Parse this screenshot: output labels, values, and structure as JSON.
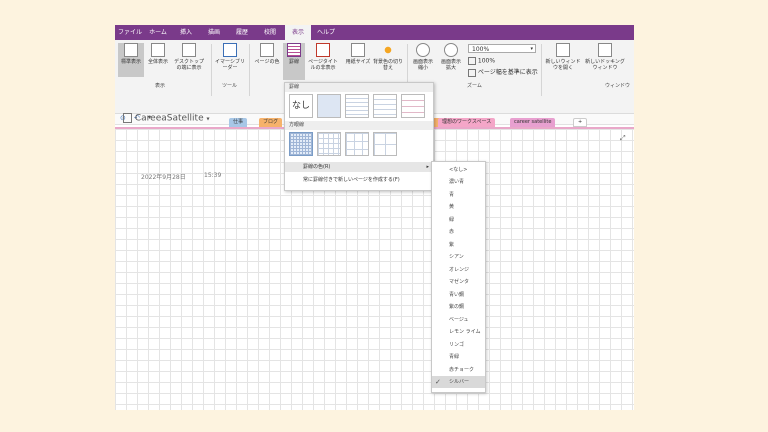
{
  "menu": {
    "tabs": [
      "ファイル",
      "ホーム",
      "挿入",
      "描画",
      "履歴",
      "校閲",
      "表示",
      "ヘルプ"
    ],
    "active": "表示"
  },
  "ribbon": {
    "buttons": [
      "標準表示",
      "全体表示",
      "デスクトップの端に表示",
      "イマーシブリーダー",
      "ページの色",
      "罫線",
      "ページタイトルの非表示",
      "用紙サイズ",
      "背景色の切り替え",
      "画面表示縮小",
      "画面表示拡大",
      "新しいウィンドウを開く",
      "新しいドッキングウィンドウ"
    ],
    "groups": [
      "表示",
      "ツール",
      "ズーム",
      "ウィンドウ"
    ],
    "zoom_value": "100%",
    "zoom_100": "100%",
    "page_width": "ページ幅を基準に表示"
  },
  "notebook": {
    "name": "CareeaSatellite",
    "sections": [
      {
        "label": "仕事",
        "color": "#a7c7e7"
      },
      {
        "label": "ブログ",
        "color": "#f6b26b"
      },
      {
        "label": "",
        "color": "#f6b26b"
      },
      {
        "label": "理想のワークスペース",
        "color": "#f4a6c8"
      },
      {
        "label": "career satellite",
        "color": "#e8a0d0"
      },
      {
        "label": "+",
        "color": "#ffffff"
      }
    ]
  },
  "page": {
    "date": "2022年9月28日",
    "time": "15:39"
  },
  "rule_menu": {
    "header_lines": "罫線",
    "none_label": "なし",
    "header_grid": "方眼線",
    "rule_color": "罫線の色(R)",
    "always_create": "常に罫線付きで新しいページを作成する(F)"
  },
  "color_menu": {
    "items": [
      "<なし>",
      "濃い青",
      "青",
      "黄",
      "緑",
      "赤",
      "紫",
      "シアン",
      "オレンジ",
      "マゼンタ",
      "青い鋼",
      "紫の鋼",
      "ベージュ",
      "レモン ライム",
      "リンゴ",
      "青緑",
      "赤チョーク",
      "シルバー"
    ],
    "selected": "シルバー"
  },
  "colors": {
    "accent": "#7a3a8a",
    "background": "#fdf3df"
  }
}
